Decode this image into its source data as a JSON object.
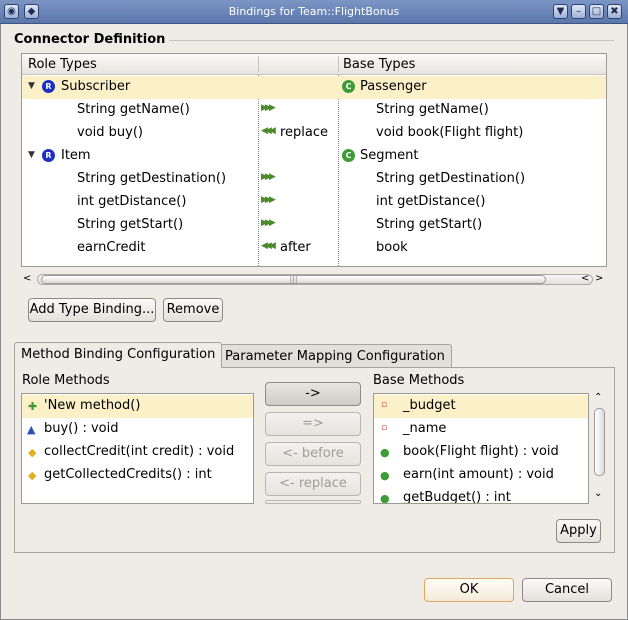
{
  "window": {
    "title": "Bindings for Team::FlightBonus",
    "menu_icon": "system-menu-icon",
    "buttons": [
      "▼",
      "–",
      "□",
      "✖"
    ]
  },
  "connector": {
    "section_title": "Connector Definition",
    "headers": {
      "role": "Role Types",
      "base": "Base Types"
    },
    "rows": [
      {
        "role": "Subscriber",
        "mid": "",
        "base": "Passenger"
      },
      {
        "role": "String getName()",
        "mid": "",
        "base": "String getName()"
      },
      {
        "role": "void buy()",
        "mid": "replace",
        "base": "void book(Flight flight)"
      },
      {
        "role": "Item",
        "mid": "",
        "base": "Segment"
      },
      {
        "role": "String getDestination()",
        "mid": "",
        "base": "String getDestination()"
      },
      {
        "role": "int getDistance()",
        "mid": "",
        "base": "int getDistance()"
      },
      {
        "role": "String getStart()",
        "mid": "",
        "base": "String getStart()"
      },
      {
        "role": "earnCredit",
        "mid": "after",
        "base": "book"
      }
    ],
    "scroll_grip": "|||",
    "add_type_binding": "Add Type Binding...",
    "remove": "Remove"
  },
  "tabs": {
    "method_binding": "Method Binding Configuration",
    "parameter_mapping": "Parameter Mapping Configuration"
  },
  "method_binding": {
    "role_methods_label": "Role Methods",
    "base_methods_label": "Base Methods",
    "role_methods": [
      "'New method()",
      "buy() : void",
      "collectCredit(int credit) : void",
      "getCollectedCredits() : int"
    ],
    "base_methods": [
      "_budget",
      "_name",
      "book(Flight flight) : void",
      "earn(int amount) : void",
      "getBudget() : int"
    ],
    "bind_buttons": [
      "->",
      "=>",
      "<- before",
      "<- replace"
    ],
    "apply": "Apply"
  },
  "dialog": {
    "ok": "OK",
    "cancel": "Cancel"
  },
  "colors": {
    "selection": "#fbf0c8",
    "title_bar": "#6b86b8",
    "role_icon": "#1b2fc4",
    "class_icon": "#3e9c36"
  }
}
